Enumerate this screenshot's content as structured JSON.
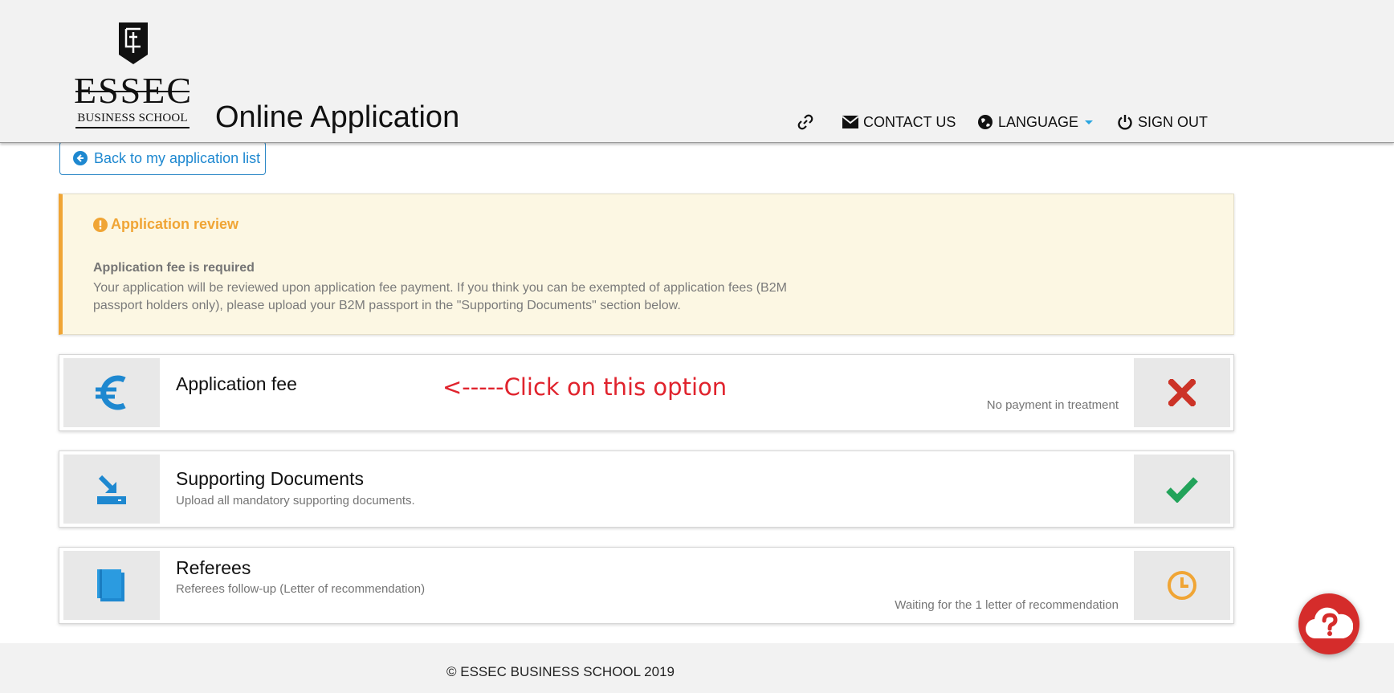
{
  "header": {
    "logo_brand": "ESSEC",
    "logo_sub": "BUSINESS SCHOOL",
    "app_title": "Online Application",
    "nav": {
      "contact": "CONTACT US",
      "language": "LANGUAGE",
      "signout": "SIGN OUT"
    }
  },
  "back_button": {
    "label": "Back to my application list"
  },
  "alert": {
    "title": "Application review",
    "strong": "Application fee is required",
    "text": "Your application will be reviewed upon application fee payment. If you think you can be exempted of application fees (B2M passport holders only), please upload your B2M passport in the \"Supporting Documents\" section below."
  },
  "cards": {
    "fee": {
      "title": "Application fee",
      "status": "No payment in treatment",
      "left_icon": "euro-icon",
      "right_icon": "cross-icon",
      "annotation": "<-----Click on this option"
    },
    "docs": {
      "title": "Supporting Documents",
      "desc": "Upload all mandatory supporting documents.",
      "left_icon": "upload-icon",
      "right_icon": "check-icon"
    },
    "referees": {
      "title": "Referees",
      "desc": "Referees follow-up (Letter of recommendation)",
      "status": "Waiting for the 1 letter of recommendation",
      "left_icon": "book-icon",
      "right_icon": "clock-icon"
    }
  },
  "footer": {
    "text": "© ESSEC BUSINESS SCHOOL 2019"
  },
  "colors": {
    "accent_blue": "#1e88d0",
    "warning_orange": "#f0a535",
    "error_red": "#cc3327",
    "success_green": "#22a35a",
    "help_red": "#d52c2b"
  }
}
